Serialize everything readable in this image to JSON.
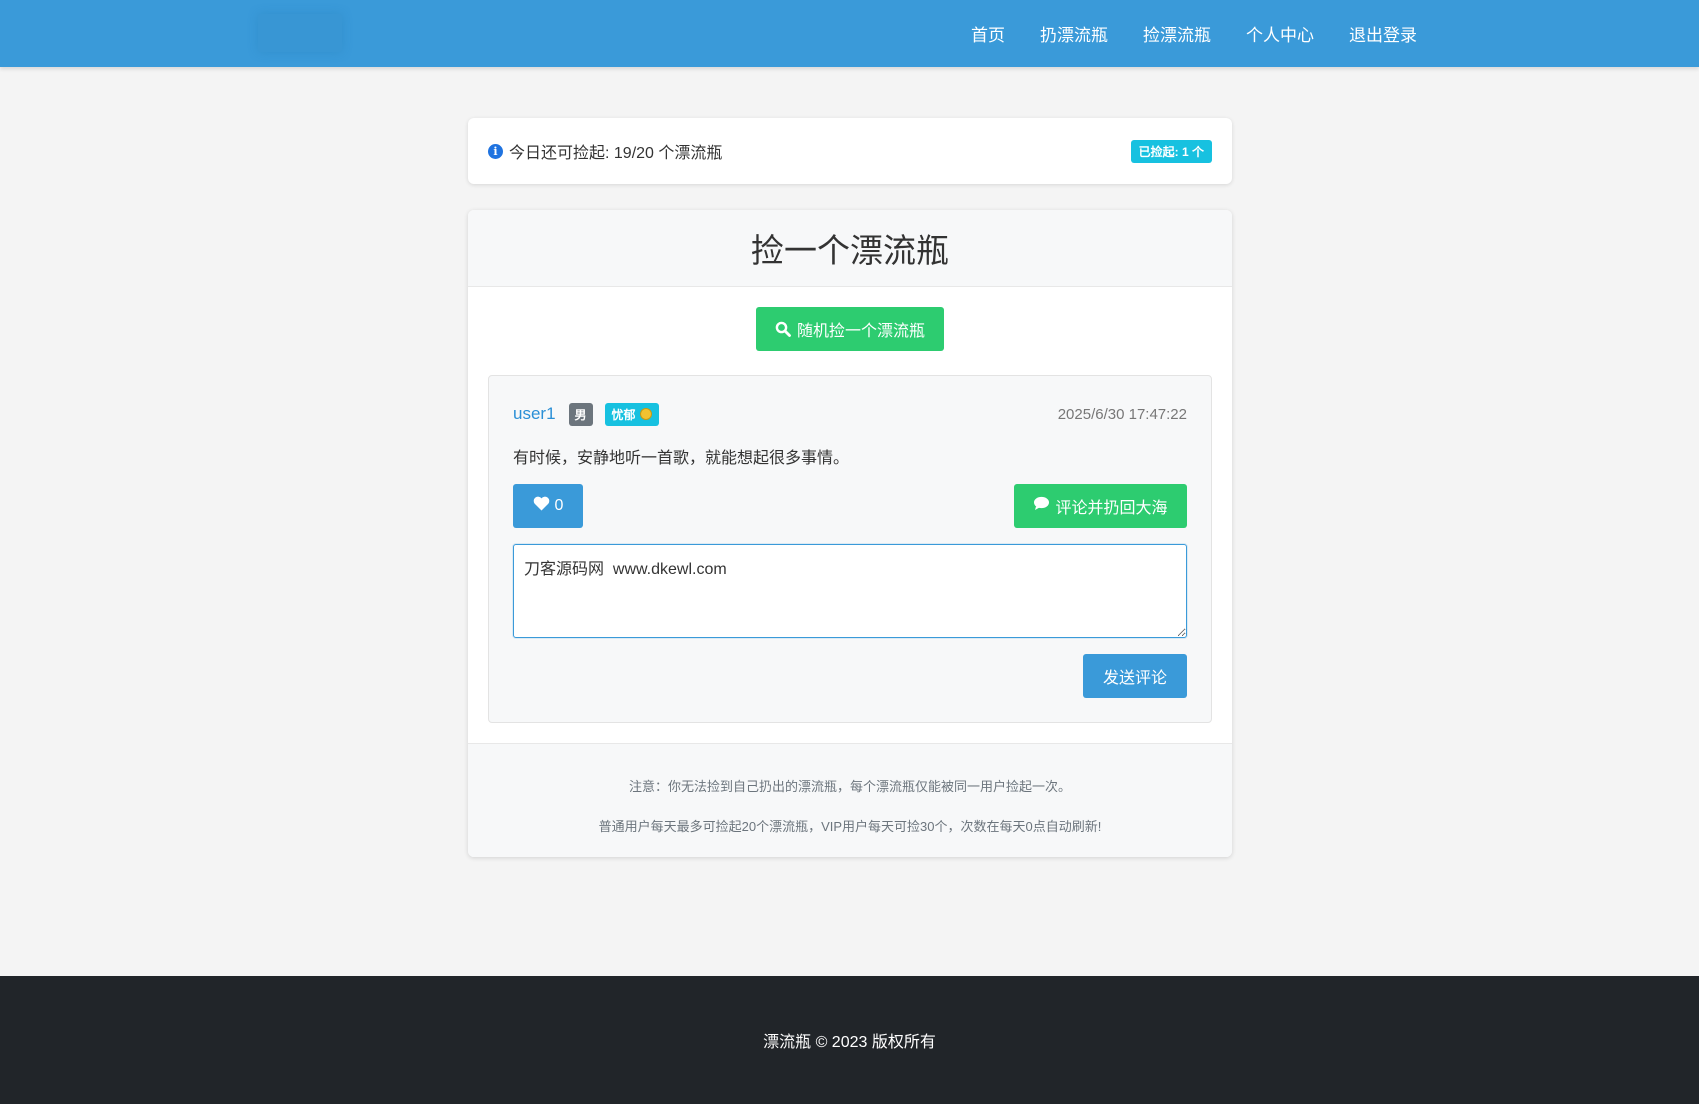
{
  "nav": {
    "items": [
      {
        "label": "首页"
      },
      {
        "label": "扔漂流瓶"
      },
      {
        "label": "捡漂流瓶"
      },
      {
        "label": "个人中心"
      },
      {
        "label": "退出登录"
      }
    ]
  },
  "info": {
    "icon": "info-circle-icon",
    "text": "今日还可捡起: 19/20 个漂流瓶",
    "badge": "已捡起: 1 个"
  },
  "main": {
    "title": "捡一个漂流瓶",
    "pick_button": "随机捡一个漂流瓶",
    "pick_icon": "search-icon",
    "bottle": {
      "username": "user1",
      "gender": "男",
      "mood": "忧郁",
      "mood_icon": "sad-face-icon",
      "time": "2025/6/30 17:47:22",
      "content": "有时候，安静地听一首歌，就能想起很多事情。",
      "like_icon": "heart-icon",
      "likes": "0",
      "comment_icon": "comment-icon",
      "comment_button": "评论并扔回大海",
      "comment_value": "刀客源码网  www.dkewl.com",
      "send_button": "发送评论"
    },
    "notes": [
      "注意：你无法捡到自己扔出的漂流瓶，每个漂流瓶仅能被同一用户捡起一次。",
      "普通用户每天最多可捡起20个漂流瓶，VIP用户每天可捡30个，次数在每天0点自动刷新!"
    ]
  },
  "footer": {
    "copyright": "漂流瓶 © 2023 版权所有"
  },
  "colors": {
    "primary": "#3a9ad9",
    "success": "#2dcc70",
    "info": "#17c1e0",
    "dark": "#212529"
  }
}
